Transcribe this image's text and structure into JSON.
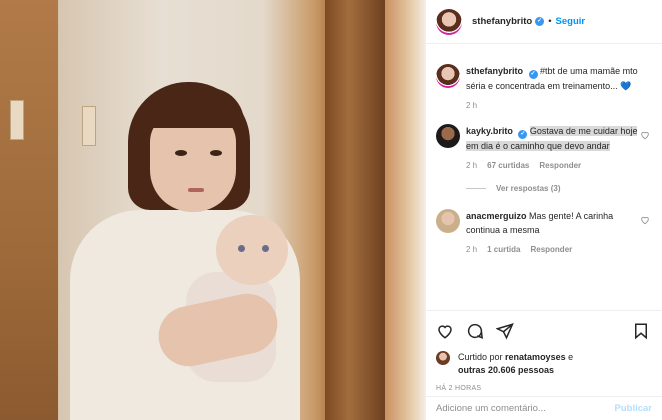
{
  "header": {
    "username": "sthefanybrito",
    "separator": "•",
    "follow_label": "Seguir"
  },
  "caption": {
    "username": "sthefanybrito",
    "text": "#tbt de uma mamãe mto séria e concentrada em treinamento...",
    "emoji": "💙",
    "time": "2 h"
  },
  "comments": [
    {
      "username": "kayky.brito",
      "verified": true,
      "text": "Gostava de me cuidar hoje em dia é o caminho que devo andar",
      "time": "2 h",
      "likes": "67 curtidas",
      "reply_label": "Responder",
      "view_replies": "Ver respostas (3)"
    },
    {
      "username": "anacmerguizo",
      "verified": false,
      "text": "Mas gente! A carinha continua a mesma",
      "time": "2 h",
      "likes": "1 curtida",
      "reply_label": "Responder"
    }
  ],
  "likes": {
    "prefix": "Curtido por",
    "user": "renatamoyses",
    "middle": "e",
    "others": "outras 20.606 pessoas"
  },
  "post_time": "HÁ 2 HORAS",
  "add_comment": {
    "placeholder": "Adicione um comentário...",
    "post_label": "Publicar"
  },
  "icons": {
    "like": "heart-icon",
    "comment": "comment-icon",
    "share": "share-icon",
    "save": "bookmark-icon",
    "verified": "verified-badge-icon"
  },
  "colors": {
    "accent": "#0095f6",
    "verified": "#3897f0",
    "muted": "#8e8e8e"
  }
}
